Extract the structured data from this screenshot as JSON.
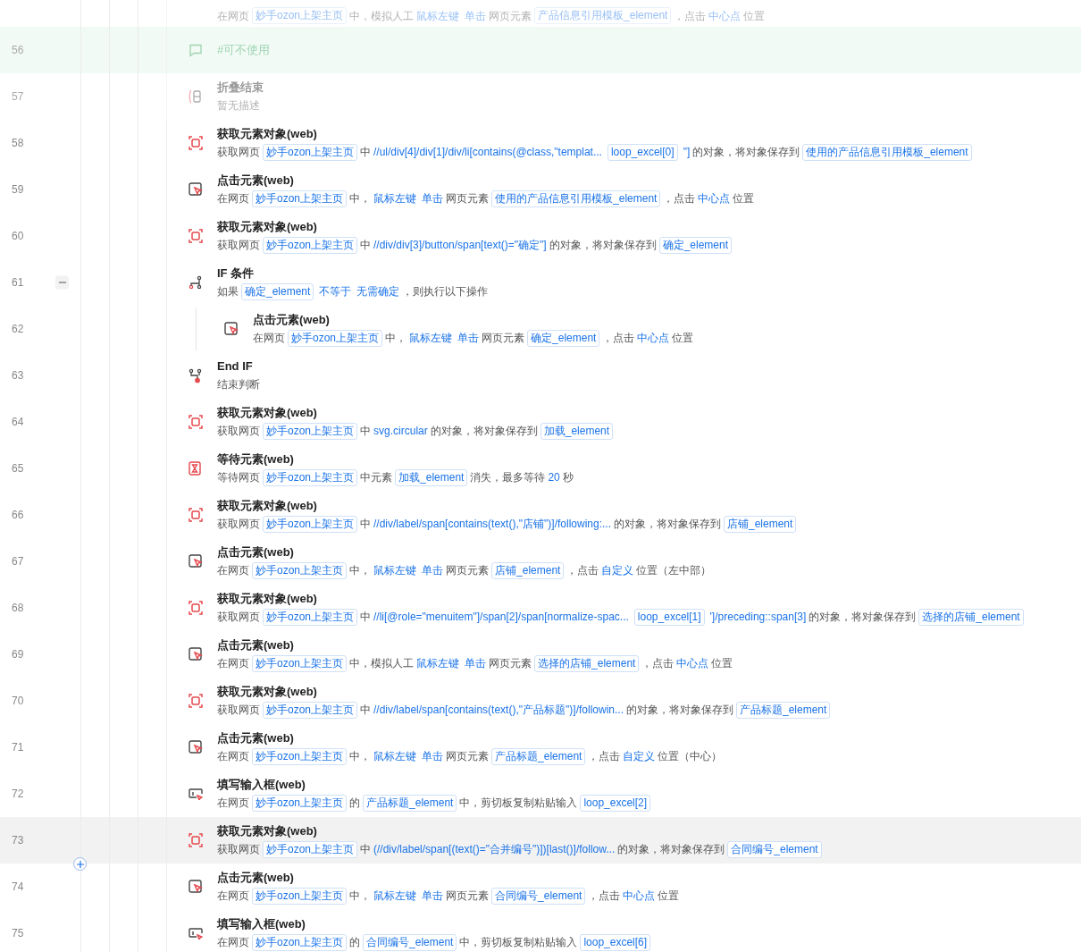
{
  "steps": [
    {
      "kind": "click",
      "disabled": true,
      "hovered": false,
      "desc": [
        {
          "kind": "text",
          "text": "在网页"
        },
        {
          "kind": "var",
          "text": "妙手ozon上架主页"
        },
        {
          "kind": "text",
          "text": "中，模拟人工"
        },
        {
          "kind": "value",
          "text": "鼠标左键"
        },
        {
          "kind": "value",
          "text": "单击"
        },
        {
          "kind": "text",
          "text": "网页元素"
        },
        {
          "kind": "var",
          "text": "产品信息引用模板_element"
        },
        {
          "kind": "text",
          "text": "，点击"
        },
        {
          "kind": "value",
          "text": "中心点"
        },
        {
          "kind": "text",
          "text": "位置"
        }
      ]
    },
    {
      "number": "56",
      "kind": "comment",
      "disabled": true,
      "hovered": false,
      "title": "#可不使用"
    },
    {
      "number": "57",
      "kind": "fold_end",
      "disabled": true,
      "hovered": false,
      "title": "折叠结束",
      "desc": [
        {
          "kind": "text",
          "text": "暂无描述"
        }
      ]
    },
    {
      "number": "58",
      "kind": "get_element",
      "disabled": false,
      "hovered": false,
      "title": "获取元素对象(web)",
      "desc": [
        {
          "kind": "text",
          "text": "获取网页"
        },
        {
          "kind": "var",
          "text": "妙手ozon上架主页"
        },
        {
          "kind": "text",
          "text": "中"
        },
        {
          "kind": "value",
          "text": "//ul/div[4]/div[1]/div/li[contains(@class,\"templat..."
        },
        {
          "kind": "var",
          "text": "loop_excel[0]"
        },
        {
          "kind": "value",
          "text": "\"]"
        },
        {
          "kind": "text",
          "text": "的对象，将对象保存到"
        },
        {
          "kind": "var",
          "text": "使用的产品信息引用模板_element"
        }
      ]
    },
    {
      "number": "59",
      "kind": "click",
      "disabled": false,
      "hovered": false,
      "title": "点击元素(web)",
      "desc": [
        {
          "kind": "text",
          "text": "在网页"
        },
        {
          "kind": "var",
          "text": "妙手ozon上架主页"
        },
        {
          "kind": "text",
          "text": "中，"
        },
        {
          "kind": "value",
          "text": "鼠标左键"
        },
        {
          "kind": "value",
          "text": "单击"
        },
        {
          "kind": "text",
          "text": "网页元素"
        },
        {
          "kind": "var",
          "text": "使用的产品信息引用模板_element"
        },
        {
          "kind": "text",
          "text": "，点击"
        },
        {
          "kind": "value",
          "text": "中心点"
        },
        {
          "kind": "text",
          "text": "位置"
        }
      ]
    },
    {
      "number": "60",
      "kind": "get_element",
      "disabled": false,
      "hovered": false,
      "title": "获取元素对象(web)",
      "desc": [
        {
          "kind": "text",
          "text": "获取网页"
        },
        {
          "kind": "var",
          "text": "妙手ozon上架主页"
        },
        {
          "kind": "text",
          "text": "中"
        },
        {
          "kind": "value",
          "text": "//div/div[3]/button/span[text()=\"确定\"]"
        },
        {
          "kind": "text",
          "text": "的对象，将对象保存到"
        },
        {
          "kind": "var",
          "text": "确定_element"
        }
      ]
    },
    {
      "number": "61",
      "kind": "if",
      "disabled": false,
      "hovered": false,
      "expanded": true,
      "title": "IF 条件",
      "desc": [
        {
          "kind": "text",
          "text": "如果"
        },
        {
          "kind": "var",
          "text": "确定_element"
        },
        {
          "kind": "value",
          "text": "不等于"
        },
        {
          "kind": "value",
          "text": "无需确定"
        },
        {
          "kind": "text",
          "text": "，则执行以下操作"
        }
      ],
      "children": [
        {
          "number": "62",
          "kind": "click",
          "disabled": false,
          "hovered": false,
          "title": "点击元素(web)",
          "desc": [
            {
              "kind": "text",
              "text": "在网页"
            },
            {
              "kind": "var",
              "text": "妙手ozon上架主页"
            },
            {
              "kind": "text",
              "text": "中，"
            },
            {
              "kind": "value",
              "text": "鼠标左键"
            },
            {
              "kind": "value",
              "text": "单击"
            },
            {
              "kind": "text",
              "text": "网页元素"
            },
            {
              "kind": "var",
              "text": "确定_element"
            },
            {
              "kind": "text",
              "text": "，点击"
            },
            {
              "kind": "value",
              "text": "中心点"
            },
            {
              "kind": "text",
              "text": "位置"
            }
          ]
        }
      ]
    },
    {
      "number": "63",
      "kind": "end_if",
      "disabled": false,
      "hovered": false,
      "title": "End IF",
      "desc": [
        {
          "kind": "text",
          "text": "结束判断"
        }
      ]
    },
    {
      "number": "64",
      "kind": "get_element",
      "disabled": false,
      "hovered": false,
      "title": "获取元素对象(web)",
      "desc": [
        {
          "kind": "text",
          "text": "获取网页"
        },
        {
          "kind": "var",
          "text": "妙手ozon上架主页"
        },
        {
          "kind": "text",
          "text": "中"
        },
        {
          "kind": "value",
          "text": "svg.circular"
        },
        {
          "kind": "text",
          "text": "的对象，将对象保存到"
        },
        {
          "kind": "var",
          "text": "加载_element"
        }
      ]
    },
    {
      "number": "65",
      "kind": "wait",
      "disabled": false,
      "hovered": false,
      "title": "等待元素(web)",
      "desc": [
        {
          "kind": "text",
          "text": "等待网页"
        },
        {
          "kind": "var",
          "text": "妙手ozon上架主页"
        },
        {
          "kind": "text",
          "text": "中元素"
        },
        {
          "kind": "var",
          "text": "加载_element"
        },
        {
          "kind": "text",
          "text": "消失，最多等待"
        },
        {
          "kind": "value",
          "text": "20"
        },
        {
          "kind": "text",
          "text": "秒"
        }
      ]
    },
    {
      "number": "66",
      "kind": "get_element",
      "disabled": false,
      "hovered": false,
      "title": "获取元素对象(web)",
      "desc": [
        {
          "kind": "text",
          "text": "获取网页"
        },
        {
          "kind": "var",
          "text": "妙手ozon上架主页"
        },
        {
          "kind": "text",
          "text": "中"
        },
        {
          "kind": "value",
          "text": "//div/label/span[contains(text(),\"店铺\")]/following:..."
        },
        {
          "kind": "text",
          "text": "的对象，将对象保存到"
        },
        {
          "kind": "var",
          "text": "店铺_element"
        }
      ]
    },
    {
      "number": "67",
      "kind": "click",
      "disabled": false,
      "hovered": false,
      "title": "点击元素(web)",
      "desc": [
        {
          "kind": "text",
          "text": "在网页"
        },
        {
          "kind": "var",
          "text": "妙手ozon上架主页"
        },
        {
          "kind": "text",
          "text": "中，"
        },
        {
          "kind": "value",
          "text": "鼠标左键"
        },
        {
          "kind": "value",
          "text": "单击"
        },
        {
          "kind": "text",
          "text": "网页元素"
        },
        {
          "kind": "var",
          "text": "店铺_element"
        },
        {
          "kind": "text",
          "text": "，点击"
        },
        {
          "kind": "value",
          "text": "自定义"
        },
        {
          "kind": "text",
          "text": "位置（左中部）"
        }
      ]
    },
    {
      "number": "68",
      "kind": "get_element",
      "disabled": false,
      "hovered": false,
      "title": "获取元素对象(web)",
      "desc": [
        {
          "kind": "text",
          "text": "获取网页"
        },
        {
          "kind": "var",
          "text": "妙手ozon上架主页"
        },
        {
          "kind": "text",
          "text": "中"
        },
        {
          "kind": "value",
          "text": "//li[@role=\"menuitem\"]/span[2]/span[normalize-spac..."
        },
        {
          "kind": "var",
          "text": "loop_excel[1]"
        },
        {
          "kind": "value",
          "text": "']/preceding::span[3]"
        },
        {
          "kind": "text",
          "text": "的对象，将对象保存到"
        },
        {
          "kind": "var",
          "text": "选择的店铺_element"
        }
      ]
    },
    {
      "number": "69",
      "kind": "click",
      "disabled": false,
      "hovered": false,
      "title": "点击元素(web)",
      "desc": [
        {
          "kind": "text",
          "text": "在网页"
        },
        {
          "kind": "var",
          "text": "妙手ozon上架主页"
        },
        {
          "kind": "text",
          "text": "中，模拟人工"
        },
        {
          "kind": "value",
          "text": "鼠标左键"
        },
        {
          "kind": "value",
          "text": "单击"
        },
        {
          "kind": "text",
          "text": "网页元素"
        },
        {
          "kind": "var",
          "text": "选择的店铺_element"
        },
        {
          "kind": "text",
          "text": "，点击"
        },
        {
          "kind": "value",
          "text": "中心点"
        },
        {
          "kind": "text",
          "text": "位置"
        }
      ]
    },
    {
      "number": "70",
      "kind": "get_element",
      "disabled": false,
      "hovered": false,
      "title": "获取元素对象(web)",
      "desc": [
        {
          "kind": "text",
          "text": "获取网页"
        },
        {
          "kind": "var",
          "text": "妙手ozon上架主页"
        },
        {
          "kind": "text",
          "text": "中"
        },
        {
          "kind": "value",
          "text": "//div/label/span[contains(text(),\"产品标题\")]/followin..."
        },
        {
          "kind": "text",
          "text": "的对象，将对象保存到"
        },
        {
          "kind": "var",
          "text": "产品标题_element"
        }
      ]
    },
    {
      "number": "71",
      "kind": "click",
      "disabled": false,
      "hovered": false,
      "title": "点击元素(web)",
      "desc": [
        {
          "kind": "text",
          "text": "在网页"
        },
        {
          "kind": "var",
          "text": "妙手ozon上架主页"
        },
        {
          "kind": "text",
          "text": "中，"
        },
        {
          "kind": "value",
          "text": "鼠标左键"
        },
        {
          "kind": "value",
          "text": "单击"
        },
        {
          "kind": "text",
          "text": "网页元素"
        },
        {
          "kind": "var",
          "text": "产品标题_element"
        },
        {
          "kind": "text",
          "text": "，点击"
        },
        {
          "kind": "value",
          "text": "自定义"
        },
        {
          "kind": "text",
          "text": "位置（中心）"
        }
      ]
    },
    {
      "number": "72",
      "kind": "fill",
      "disabled": false,
      "hovered": false,
      "title": "填写输入框(web)",
      "desc": [
        {
          "kind": "text",
          "text": "在网页"
        },
        {
          "kind": "var",
          "text": "妙手ozon上架主页"
        },
        {
          "kind": "text",
          "text": "的"
        },
        {
          "kind": "var",
          "text": "产品标题_element"
        },
        {
          "kind": "text",
          "text": "中，剪切板复制粘贴输入"
        },
        {
          "kind": "var",
          "text": "loop_excel[2]"
        }
      ]
    },
    {
      "number": "73",
      "kind": "get_element",
      "disabled": false,
      "hovered": true,
      "title": "获取元素对象(web)",
      "desc": [
        {
          "kind": "text",
          "text": "获取网页"
        },
        {
          "kind": "var",
          "text": "妙手ozon上架主页"
        },
        {
          "kind": "text",
          "text": "中"
        },
        {
          "kind": "value",
          "text": "(//div/label/span[(text()=\"合并编号\")])[last()]/follow..."
        },
        {
          "kind": "text",
          "text": "的对象，将对象保存到"
        },
        {
          "kind": "var",
          "text": "合同编号_element"
        }
      ]
    },
    {
      "number": "74",
      "kind": "click",
      "disabled": false,
      "hovered": false,
      "title": "点击元素(web)",
      "desc": [
        {
          "kind": "text",
          "text": "在网页"
        },
        {
          "kind": "var",
          "text": "妙手ozon上架主页"
        },
        {
          "kind": "text",
          "text": "中，"
        },
        {
          "kind": "value",
          "text": "鼠标左键"
        },
        {
          "kind": "value",
          "text": "单击"
        },
        {
          "kind": "text",
          "text": "网页元素"
        },
        {
          "kind": "var",
          "text": "合同编号_element"
        },
        {
          "kind": "text",
          "text": "，点击"
        },
        {
          "kind": "value",
          "text": "中心点"
        },
        {
          "kind": "text",
          "text": "位置"
        }
      ]
    },
    {
      "number": "75",
      "kind": "fill",
      "disabled": false,
      "hovered": false,
      "title": "填写输入框(web)",
      "desc": [
        {
          "kind": "text",
          "text": "在网页"
        },
        {
          "kind": "var",
          "text": "妙手ozon上架主页"
        },
        {
          "kind": "text",
          "text": "的"
        },
        {
          "kind": "var",
          "text": "合同编号_element"
        },
        {
          "kind": "text",
          "text": "中，剪切板复制粘贴输入"
        },
        {
          "kind": "var",
          "text": "loop_excel[6]"
        }
      ]
    }
  ]
}
